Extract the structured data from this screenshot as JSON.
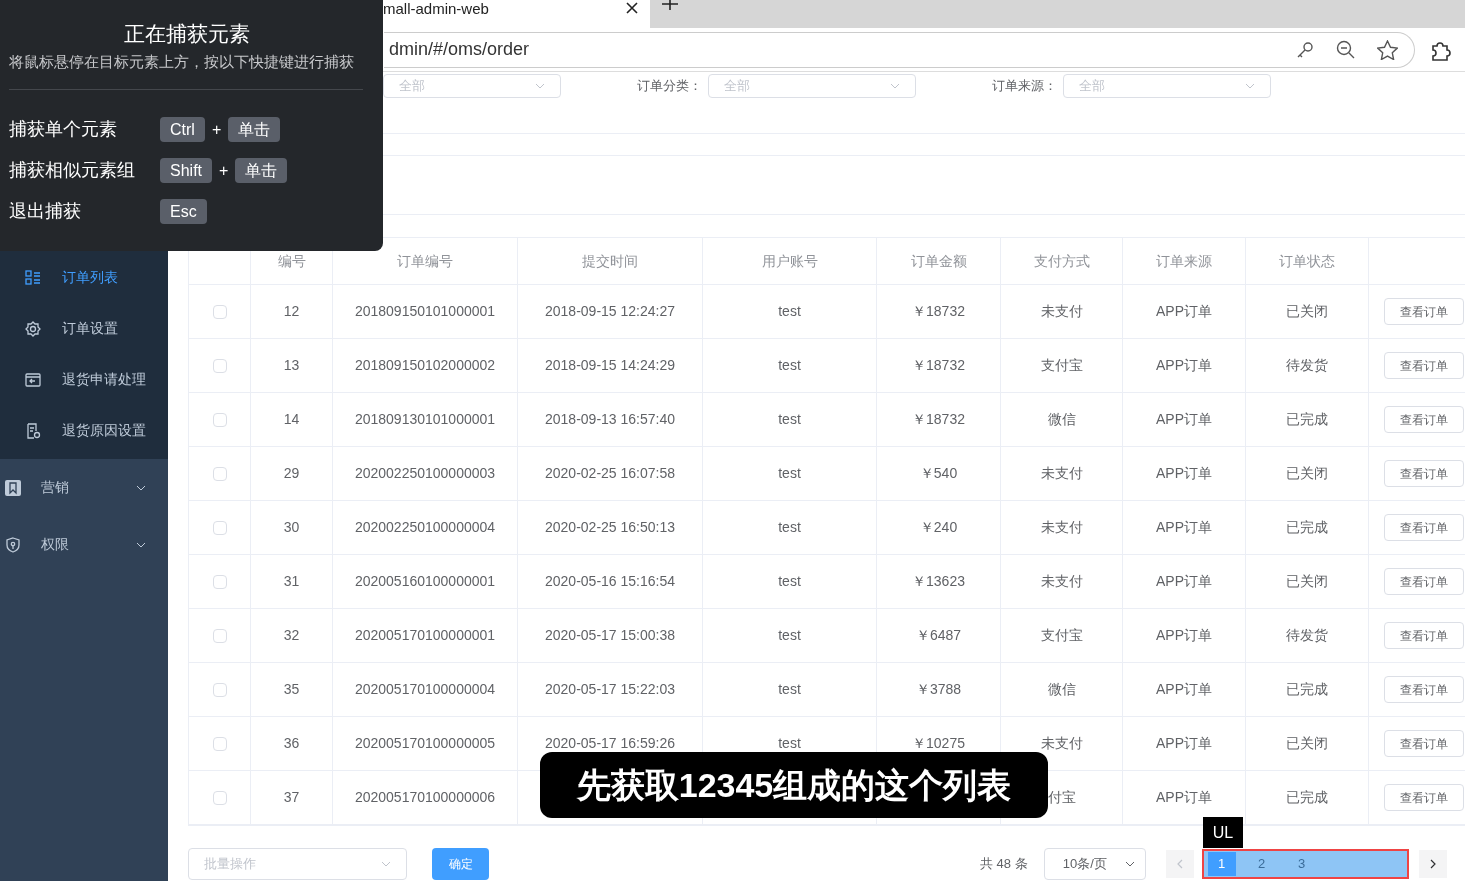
{
  "browser": {
    "tab_title": "mall-admin-web",
    "url": "dmin/#/oms/order"
  },
  "capture_panel": {
    "title": "正在捕获元素",
    "hint": "将鼠标悬停在目标元素上方，按以下快捷键进行捕获",
    "shortcuts": [
      {
        "label": "捕获单个元素",
        "keys": [
          "Ctrl",
          "单击"
        ],
        "joiner": "+"
      },
      {
        "label": "捕获相似元素组",
        "keys": [
          "Shift",
          "单击"
        ],
        "joiner": "+"
      },
      {
        "label": "退出捕获",
        "keys": [
          "Esc"
        ]
      }
    ]
  },
  "sidebar": {
    "submenu": [
      {
        "label": "订单列表",
        "selected": true
      },
      {
        "label": "订单设置",
        "selected": false
      },
      {
        "label": "退货申请处理",
        "selected": false
      },
      {
        "label": "退货原因设置",
        "selected": false
      }
    ],
    "sections": [
      {
        "label": "营销",
        "expanded": false
      },
      {
        "label": "权限",
        "expanded": false
      }
    ]
  },
  "filters": [
    {
      "placeholder": "全部"
    },
    {
      "label": "订单分类：",
      "placeholder": "全部"
    },
    {
      "label": "订单来源：",
      "placeholder": "全部"
    }
  ],
  "table": {
    "columns": [
      "编号",
      "订单编号",
      "提交时间",
      "用户账号",
      "订单金额",
      "支付方式",
      "订单来源",
      "订单状态"
    ],
    "rows": [
      {
        "checked": false,
        "action": "查看订单",
        "cells": [
          "12",
          "201809150101000001",
          "2018-09-15 12:24:27",
          "test",
          "￥18732",
          "未支付",
          "APP订单",
          "已关闭"
        ]
      },
      {
        "checked": false,
        "action": "查看订单",
        "cells": [
          "13",
          "201809150102000002",
          "2018-09-15 14:24:29",
          "test",
          "￥18732",
          "支付宝",
          "APP订单",
          "待发货"
        ]
      },
      {
        "checked": false,
        "action": "查看订单",
        "cells": [
          "14",
          "201809130101000001",
          "2018-09-13 16:57:40",
          "test",
          "￥18732",
          "微信",
          "APP订单",
          "已完成"
        ]
      },
      {
        "checked": false,
        "action": "查看订单",
        "cells": [
          "29",
          "202002250100000003",
          "2020-02-25 16:07:58",
          "test",
          "￥540",
          "未支付",
          "APP订单",
          "已关闭"
        ]
      },
      {
        "checked": false,
        "action": "查看订单",
        "cells": [
          "30",
          "202002250100000004",
          "2020-02-25 16:50:13",
          "test",
          "￥240",
          "未支付",
          "APP订单",
          "已完成"
        ]
      },
      {
        "checked": false,
        "action": "查看订单",
        "cells": [
          "31",
          "202005160100000001",
          "2020-05-16 15:16:54",
          "test",
          "￥13623",
          "未支付",
          "APP订单",
          "已关闭"
        ]
      },
      {
        "checked": false,
        "action": "查看订单",
        "cells": [
          "32",
          "202005170100000001",
          "2020-05-17 15:00:38",
          "test",
          "￥6487",
          "支付宝",
          "APP订单",
          "待发货"
        ]
      },
      {
        "checked": false,
        "action": "查看订单",
        "cells": [
          "35",
          "202005170100000004",
          "2020-05-17 15:22:03",
          "test",
          "￥3788",
          "微信",
          "APP订单",
          "已完成"
        ]
      },
      {
        "checked": false,
        "action": "查看订单",
        "cells": [
          "36",
          "202005170100000005",
          "2020-05-17 16:59:26",
          "test",
          "￥10275",
          "未支付",
          "APP订单",
          "已关闭"
        ]
      },
      {
        "checked": false,
        "action": "查看订单",
        "cells": [
          "37",
          "202005170100000006",
          null,
          null,
          null,
          "付宝",
          "APP订单",
          "已完成"
        ]
      }
    ]
  },
  "footer": {
    "batch_placeholder": "批量操作",
    "confirm": "确定",
    "total": "共 48 条",
    "page_size": "10条/页",
    "pages": [
      {
        "label": "1",
        "selected": true
      },
      {
        "label": "2",
        "selected": false
      },
      {
        "label": "3",
        "selected": false
      }
    ]
  },
  "subtitle": "先获取12345组成的这个列表",
  "element_tooltip": "UL"
}
